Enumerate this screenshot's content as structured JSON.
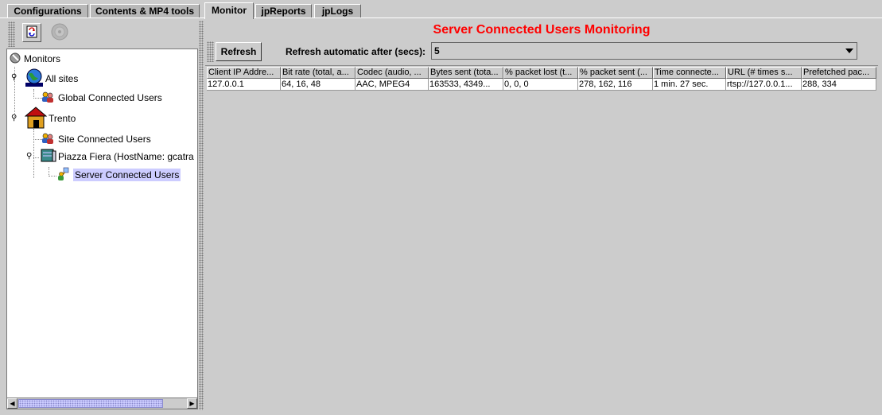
{
  "tabs": [
    {
      "label": "Configurations"
    },
    {
      "label": "Contents & MP4 tools"
    },
    {
      "label": "Monitor"
    },
    {
      "label": "jpReports"
    },
    {
      "label": "jpLogs"
    }
  ],
  "active_tab": "Monitor",
  "toolbar": {
    "refresh_tree_icon": "refresh-icon",
    "disabled_icon": "record-icon"
  },
  "tree": {
    "root": "Monitors",
    "all_sites": "All sites",
    "global_users": "Global Connected Users",
    "site": "Trento",
    "site_users": "Site Connected Users",
    "server": "Piazza Fiera (HostName: gcatra",
    "server_users": "Server Connected Users",
    "selected": "Server Connected Users"
  },
  "main": {
    "title": "Server Connected Users Monitoring",
    "title_color": "#ff0000",
    "refresh_label": "Refresh",
    "auto_label": "Refresh automatic after (secs):",
    "auto_value": "5"
  },
  "table": {
    "columns": [
      "Client IP Addre...",
      "Bit rate (total, a...",
      "Codec (audio, ...",
      "Bytes sent (tota...",
      "% packet lost (t...",
      "% packet sent (...",
      "Time connecte...",
      "URL (# times s...",
      "Prefetched pac..."
    ],
    "rows": [
      [
        "127.0.0.1",
        "64, 16, 48",
        "AAC, MPEG4",
        "163533, 4349...",
        "0, 0, 0",
        "278, 162, 116",
        "1 min. 27 sec.",
        "rtsp://127.0.0.1...",
        "288, 334"
      ]
    ]
  }
}
